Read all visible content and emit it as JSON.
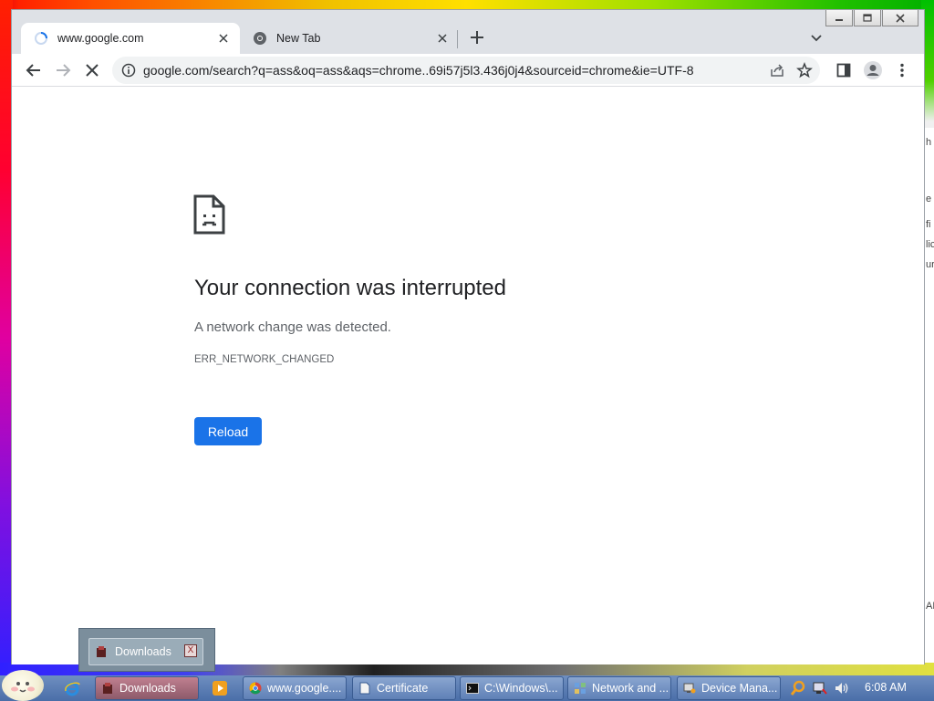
{
  "browser": {
    "tabs": [
      {
        "title": "www.google.com",
        "active": true,
        "loading": true
      },
      {
        "title": "New Tab",
        "active": false
      }
    ],
    "address": "google.com/search?q=ass&oq=ass&aqs=chrome..69i57j5l3.436j0j4&sourceid=chrome&ie=UTF-8"
  },
  "error_page": {
    "title": "Your connection was interrupted",
    "subtitle": "A network change was detected.",
    "code": "ERR_NETWORK_CHANGED",
    "reload_label": "Reload"
  },
  "thumbnail": {
    "label": "Downloads",
    "close_glyph": "X"
  },
  "taskbar": {
    "tasks": [
      {
        "label": "Downloads",
        "icon": "downloads-icon",
        "pressed": true
      },
      {
        "label": "www.google....",
        "icon": "chrome-icon"
      },
      {
        "label": "Certificate",
        "icon": "document-icon"
      },
      {
        "label": "C:\\Windows\\...",
        "icon": "cmd-icon"
      },
      {
        "label": "Network and ...",
        "icon": "network-icon"
      },
      {
        "label": "Device Mana...",
        "icon": "device-manager-icon"
      }
    ],
    "clock": "6:08 AM"
  },
  "desktop_right_strip": [
    "h",
    "e",
    "fi",
    "lic",
    "ur",
    "AM"
  ],
  "colors": {
    "accent": "#1a73e8",
    "taskbar": "#4a6ea8"
  }
}
